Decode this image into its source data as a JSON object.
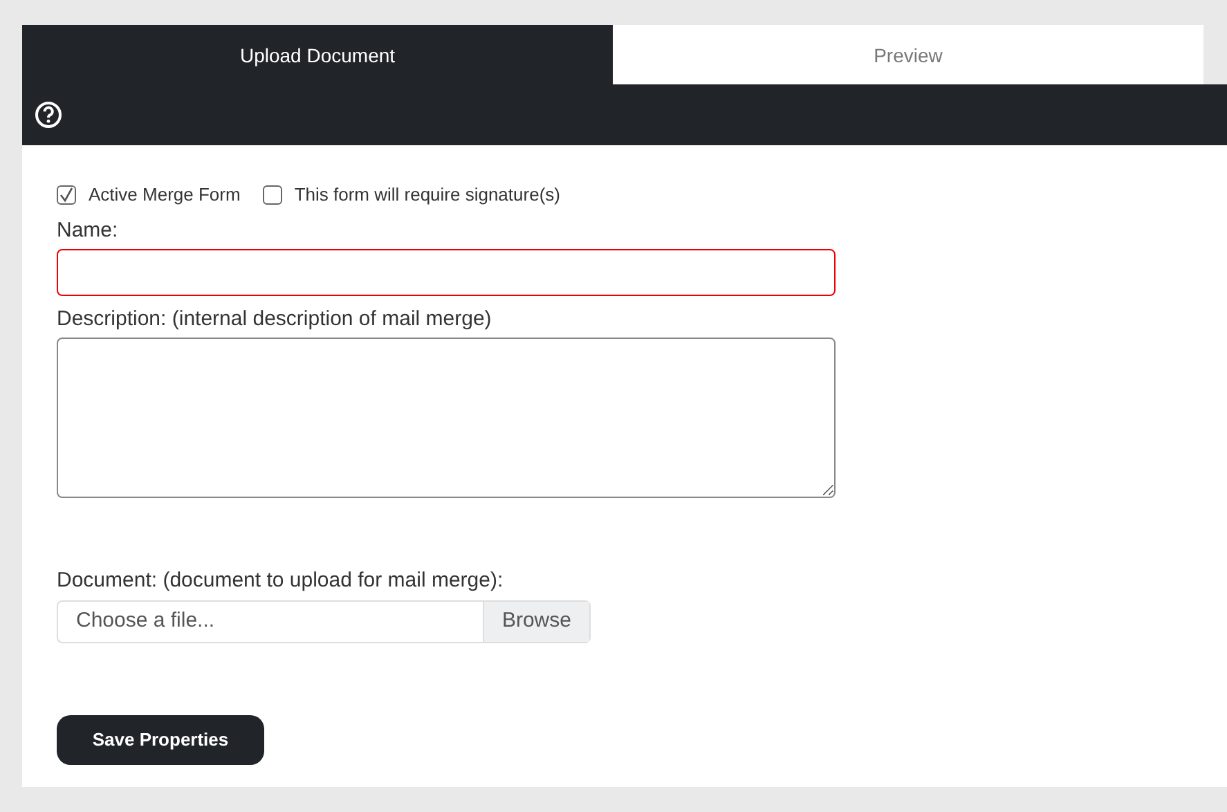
{
  "tabs": [
    {
      "label": "Upload Document",
      "selected": true
    },
    {
      "label": "Preview",
      "selected": false
    }
  ],
  "checkboxes": [
    {
      "label": "Active Merge Form",
      "checked": true
    },
    {
      "label": "This form will require signature(s)",
      "checked": false
    }
  ],
  "name_field": {
    "label": "Name:",
    "invalid": true
  },
  "description_field": {
    "label": "Description: (internal description of mail merge)"
  },
  "document_field": {
    "label": "Document: (document to upload for mail merge):",
    "placeholder": "Choose a file...",
    "button": "Browse"
  },
  "save_button": "Save Properties"
}
